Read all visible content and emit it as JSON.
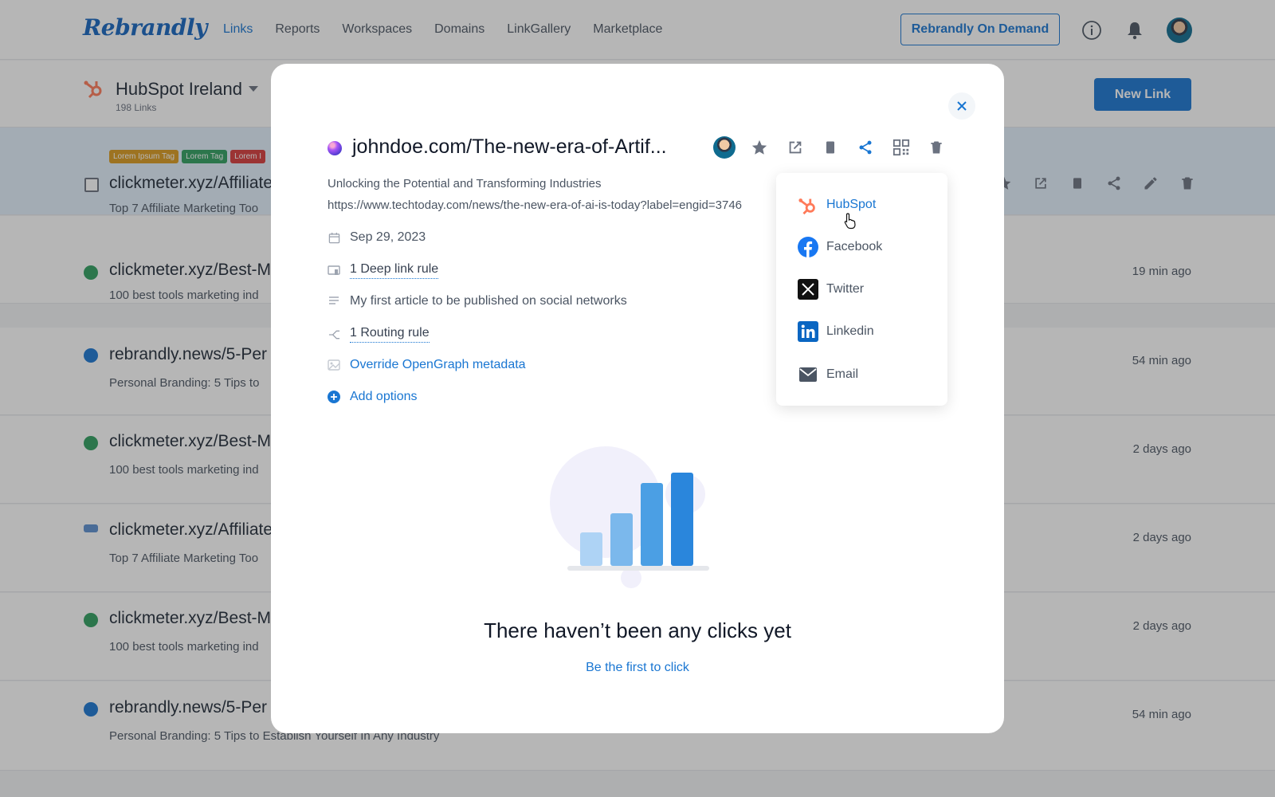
{
  "nav": {
    "logo": "Rebrandly",
    "links": [
      "Links",
      "Reports",
      "Workspaces",
      "Domains",
      "LinkGallery",
      "Marketplace"
    ],
    "active": "Links",
    "on_demand_label": "Rebrandly On Demand",
    "icons": [
      "info-icon",
      "bell-icon",
      "avatar"
    ]
  },
  "workspace": {
    "name": "HubSpot Ireland",
    "count": "198 Links",
    "new_link_label": "New Link"
  },
  "links": [
    {
      "tags": [
        "Lorem Ipsum Tag",
        "Lorem Tag",
        "Lorem I"
      ],
      "title": "clickmeter.xyz/Affiliate",
      "subtitle": "Top 7 Affiliate Marketing Too",
      "time": "",
      "selected": true
    },
    {
      "title": "clickmeter.xyz/Best-M",
      "subtitle": "100 best tools marketing ind",
      "time": "19 min ago"
    },
    {
      "title": "rebrandly.news/5-Per",
      "subtitle": "Personal Branding: 5 Tips to",
      "time": "54 min ago"
    },
    {
      "title": "clickmeter.xyz/Best-M",
      "subtitle": "100 best tools marketing ind",
      "time": "2 days ago"
    },
    {
      "title": "clickmeter.xyz/Affiliate",
      "subtitle": "Top 7 Affiliate Marketing Too",
      "time": "2 days ago"
    },
    {
      "title": "clickmeter.xyz/Best-M",
      "subtitle": "100 best tools marketing ind",
      "time": "2 days ago"
    },
    {
      "title": "rebrandly.news/5-Per",
      "subtitle": "Personal Branding: 5 Tips to Establish Yourself In Any Industry",
      "time": "54 min ago"
    }
  ],
  "tag_colors": [
    "#d99a1e",
    "#2e9e5e",
    "#d63b3b"
  ],
  "modal": {
    "short_link": "johndoe.com/The-new-era-of-Artif...",
    "description": "Unlocking the Potential and Transforming Industries",
    "destination": "https://www.techtoday.com/news/the-new-era-of-ai-is-today?label=engid=3746",
    "date": "Sep 29, 2023",
    "deep_link_rule": "1 Deep link rule",
    "note": "My first article to be published on social networks",
    "routing_rule": "1 Routing rule",
    "override_og": "Override OpenGraph metadata",
    "add_options": "Add options",
    "empty_title": "There haven’t been any clicks yet",
    "empty_cta": "Be the first to click",
    "action_icons": [
      "avatar",
      "star-icon",
      "external-link-icon",
      "copy-icon",
      "share-icon",
      "qr-code-icon",
      "trash-icon"
    ]
  },
  "share_menu": {
    "items": [
      "HubSpot",
      "Facebook",
      "Twitter",
      "Linkedin",
      "Email"
    ],
    "hovered": "HubSpot"
  },
  "colors": {
    "accent": "#1976d2",
    "hubspot": "#ff7a59",
    "facebook": "#1877f2",
    "linkedin": "#0a66c2"
  }
}
